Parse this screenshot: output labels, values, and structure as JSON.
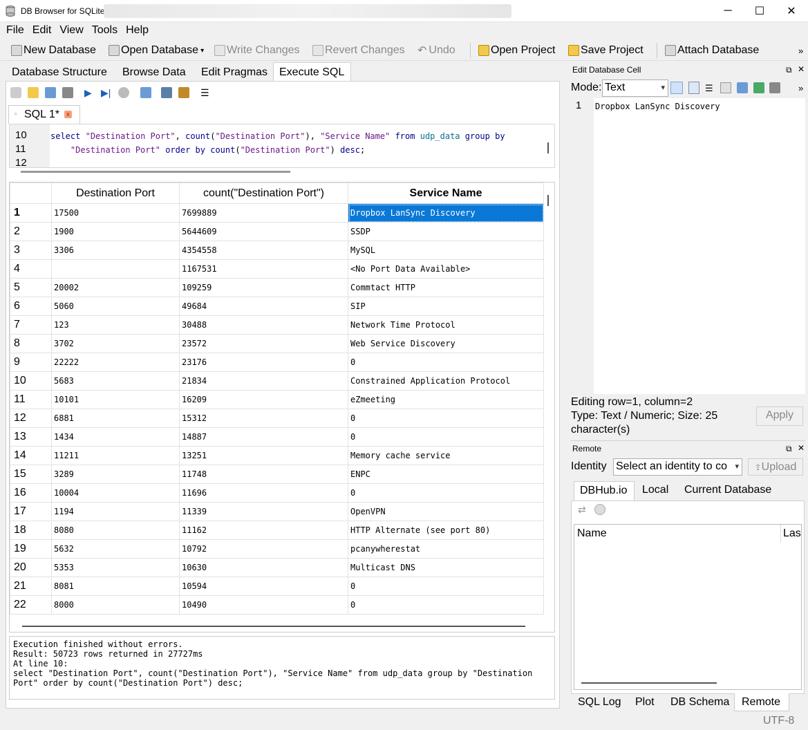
{
  "window": {
    "title": "DB Browser for SQLite",
    "minimize": "─",
    "maximize": "☐",
    "close": "✕"
  },
  "menu": [
    "File",
    "Edit",
    "View",
    "Tools",
    "Help"
  ],
  "toolbar": {
    "new_db": "New Database",
    "open_db": "Open Database",
    "write": "Write Changes",
    "revert": "Revert Changes",
    "undo": "Undo",
    "open_project": "Open Project",
    "save_project": "Save Project",
    "attach": "Attach Database",
    "more": "»"
  },
  "tabs": [
    "Database Structure",
    "Browse Data",
    "Edit Pragmas",
    "Execute SQL"
  ],
  "sql_tab": {
    "label": "SQL 1*"
  },
  "editor": {
    "line_numbers": [
      "10",
      "11",
      "12"
    ]
  },
  "grid": {
    "headers": [
      "Destination Port",
      "count(\"Destination Port\")",
      "Service Name"
    ],
    "rows": [
      [
        "1",
        "17500",
        "7699889",
        "Dropbox LanSync Discovery"
      ],
      [
        "2",
        "1900",
        "5644609",
        "SSDP"
      ],
      [
        "3",
        "3306",
        "4354558",
        "MySQL"
      ],
      [
        "4",
        "",
        "1167531",
        "<No Port Data Available>"
      ],
      [
        "5",
        "20002",
        "109259",
        "Commtact HTTP"
      ],
      [
        "6",
        "5060",
        "49684",
        "SIP"
      ],
      [
        "7",
        "123",
        "30488",
        "Network Time Protocol"
      ],
      [
        "8",
        "3702",
        "23572",
        "Web Service Discovery"
      ],
      [
        "9",
        "22222",
        "23176",
        "0"
      ],
      [
        "10",
        "5683",
        "21834",
        "Constrained Application Protocol"
      ],
      [
        "11",
        "10101",
        "16209",
        "eZmeeting"
      ],
      [
        "12",
        "6881",
        "15312",
        "0"
      ],
      [
        "13",
        "1434",
        "14887",
        "0"
      ],
      [
        "14",
        "11211",
        "13251",
        "Memory cache service"
      ],
      [
        "15",
        "3289",
        "11748",
        "ENPC"
      ],
      [
        "16",
        "10004",
        "11696",
        "0"
      ],
      [
        "17",
        "1194",
        "11339",
        "OpenVPN"
      ],
      [
        "18",
        "8080",
        "11162",
        "HTTP Alternate (see port 80)"
      ],
      [
        "19",
        "5632",
        "10792",
        "pcanywherestat"
      ],
      [
        "20",
        "5353",
        "10630",
        "Multicast DNS"
      ],
      [
        "21",
        "8081",
        "10594",
        "0"
      ],
      [
        "22",
        "8000",
        "10490",
        "0"
      ]
    ]
  },
  "message": "Execution finished without errors.\nResult: 50723 rows returned in 27727ms\nAt line 10:\nselect \"Destination Port\", count(\"Destination Port\"), \"Service Name\" from udp_data group by \"Destination\nPort\" order by count(\"Destination Port\") desc;",
  "edit_cell": {
    "title": "Edit Database Cell",
    "mode_label": "Mode:",
    "mode_value": "Text",
    "line": "1",
    "content": "Dropbox LanSync Discovery",
    "editing": "Editing row=1, column=2",
    "type": "Type: Text / Numeric; Size: 25",
    "type2": "character(s)",
    "apply": "Apply"
  },
  "remote": {
    "title": "Remote",
    "identity_label": "Identity",
    "identity_value": "Select an identity to co",
    "upload": "Upload",
    "tabs": [
      "DBHub.io",
      "Local",
      "Current Database"
    ],
    "col_name": "Name",
    "col_last": "Las"
  },
  "bottom_tabs": [
    "SQL Log",
    "Plot",
    "DB Schema",
    "Remote"
  ],
  "status": {
    "encoding": "UTF-8"
  }
}
